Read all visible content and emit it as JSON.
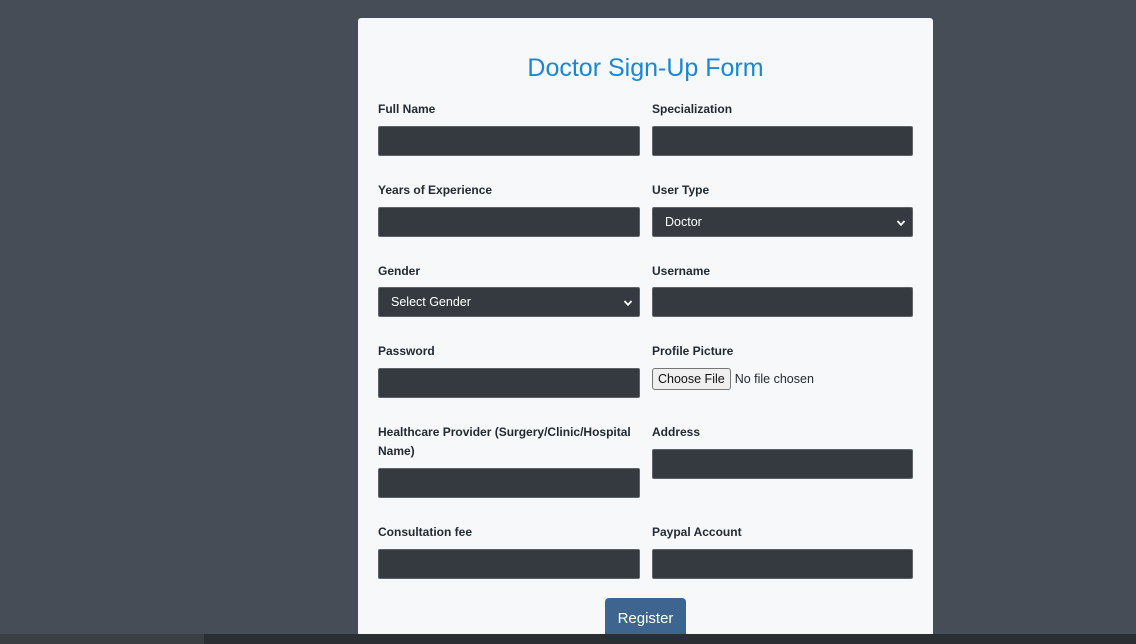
{
  "form": {
    "title": "Doctor Sign-Up Form",
    "fields": {
      "full_name": {
        "label": "Full Name",
        "value": ""
      },
      "specialization": {
        "label": "Specialization",
        "value": ""
      },
      "years_experience": {
        "label": "Years of Experience",
        "value": ""
      },
      "user_type": {
        "label": "User Type",
        "value": "Doctor"
      },
      "gender": {
        "label": "Gender",
        "value": "Select Gender"
      },
      "username": {
        "label": "Username",
        "value": ""
      },
      "password": {
        "label": "Password",
        "value": ""
      },
      "profile_picture": {
        "label": "Profile Picture",
        "button": "Choose File",
        "status": "No file chosen"
      },
      "healthcare_provider": {
        "label": "Healthcare Provider (Surgery/Clinic/Hospital Name)",
        "value": ""
      },
      "address": {
        "label": "Address",
        "value": ""
      },
      "consultation_fee": {
        "label": "Consultation fee",
        "value": ""
      },
      "paypal": {
        "label": "Paypal Account",
        "value": ""
      }
    },
    "register_label": "Register"
  },
  "colors": {
    "page_bg": "#474d56",
    "card_bg": "#f6f8f9",
    "title": "#1b86d6",
    "input_bg": "#343a40",
    "button_bg": "#3d6590"
  },
  "icons": {
    "select_arrow": "chevron-down-icon"
  }
}
